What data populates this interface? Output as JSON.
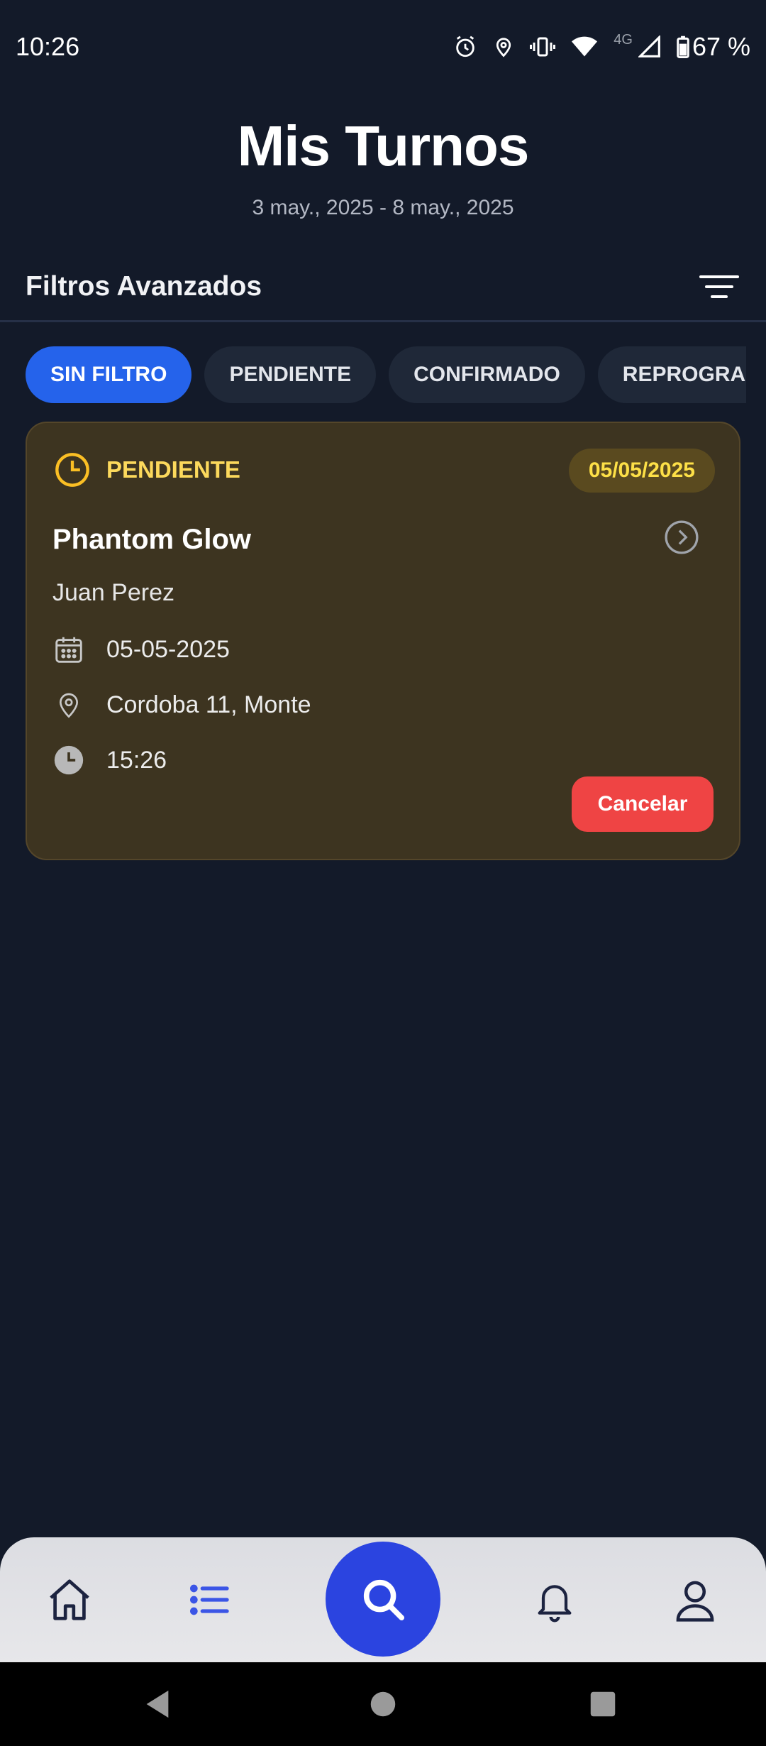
{
  "status_bar": {
    "time": "10:26",
    "network": "4G",
    "battery": "67 %",
    "icons": [
      "alarm-icon",
      "location-icon",
      "vibrate-icon",
      "wifi-icon",
      "signal-icon",
      "battery-icon"
    ]
  },
  "header": {
    "title": "Mis Turnos",
    "date_range": "3 may., 2025 - 8 may., 2025"
  },
  "filters": {
    "title": "Filtros Avanzados",
    "chips": [
      "SIN FILTRO",
      "PENDIENTE",
      "CONFIRMADO",
      "REPROGRAMADO"
    ],
    "active_chip": "SIN FILTRO"
  },
  "appointment": {
    "status": "PENDIENTE",
    "date_badge": "05/05/2025",
    "business": "Phantom Glow",
    "client": "Juan Perez",
    "date": "05-05-2025",
    "address": "Cordoba 11, Monte",
    "time": "15:26",
    "cancel_label": "Cancelar"
  },
  "bottom_nav": {
    "items": [
      "home-icon",
      "list-icon",
      "search-icon",
      "bell-icon",
      "user-icon"
    ],
    "active": "list-icon"
  },
  "colors": {
    "background": "#131a29",
    "accent": "#2563eb",
    "pending": "#fcd95c",
    "cancel": "#ef4444",
    "nav_search": "#2b44e0"
  }
}
